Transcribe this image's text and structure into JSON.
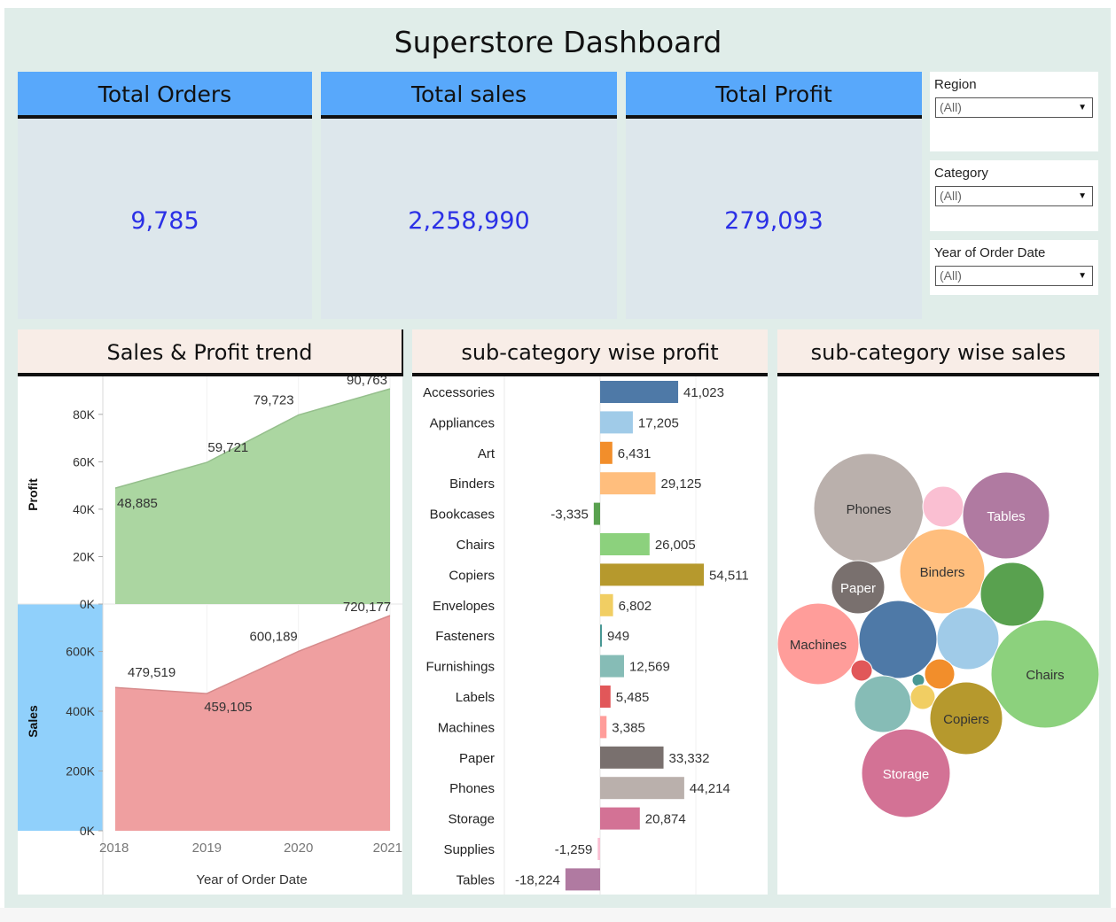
{
  "dashboard": {
    "title": "Superstore Dashboard"
  },
  "kpis": [
    {
      "label": "Total Orders",
      "value": "9,785"
    },
    {
      "label": "Total sales",
      "value": "2,258,990"
    },
    {
      "label": "Total Profit",
      "value": "279,093"
    }
  ],
  "filters": [
    {
      "label": "Region",
      "value": "(All)"
    },
    {
      "label": "Category",
      "value": "(All)"
    },
    {
      "label": "Year of Order Date",
      "value": "(All)"
    }
  ],
  "panels": {
    "trend_title": "Sales & Profit trend",
    "profit_title": "sub-category wise profit",
    "sales_title": "sub-category wise sales"
  },
  "colors": {
    "kpi_header": "#58a8fb",
    "kpi_value": "#2b30e6",
    "profit_area": "#a6d49c",
    "sales_area": "#ee9a9b",
    "sales_band": "#90d0fb"
  },
  "chart_data": [
    {
      "type": "area",
      "xlabel": "Year of Order Date",
      "x": [
        "2018",
        "2019",
        "2020",
        "2021"
      ],
      "series": [
        {
          "name": "Profit",
          "values": [
            48885,
            59721,
            79723,
            90763
          ],
          "labels": [
            "48,885",
            "59,721",
            "79,723",
            "90,763"
          ],
          "ylim": [
            0,
            90763
          ],
          "ticks": [
            0,
            20000,
            40000,
            60000,
            80000
          ],
          "tick_labels": [
            "0K",
            "20K",
            "40K",
            "60K",
            "80K"
          ]
        },
        {
          "name": "Sales",
          "values": [
            479519,
            459105,
            600189,
            720177
          ],
          "labels": [
            "479,519",
            "459,105",
            "600,189",
            "720,177"
          ],
          "ylim": [
            0,
            720177
          ],
          "ticks": [
            0,
            200000,
            400000,
            600000
          ],
          "tick_labels": [
            "0K",
            "200K",
            "400K",
            "600K"
          ]
        }
      ]
    },
    {
      "type": "bar",
      "orientation": "horizontal",
      "categories": [
        "Accessories",
        "Appliances",
        "Art",
        "Binders",
        "Bookcases",
        "Chairs",
        "Copiers",
        "Envelopes",
        "Fasteners",
        "Furnishings",
        "Labels",
        "Machines",
        "Paper",
        "Phones",
        "Storage",
        "Supplies",
        "Tables"
      ],
      "values": [
        41023,
        17205,
        6431,
        29125,
        -3335,
        26005,
        54511,
        6802,
        949,
        12569,
        5485,
        3385,
        33332,
        44214,
        20874,
        -1259,
        -18224
      ],
      "labels": [
        "41,023",
        "17,205",
        "6,431",
        "29,125",
        "-3,335",
        "26,005",
        "54,511",
        "6,802",
        "949",
        "12,569",
        "5,485",
        "3,385",
        "33,332",
        "44,214",
        "20,874",
        "-1,259",
        "-18,224"
      ],
      "colors": [
        "#4e79a7",
        "#a0cbe8",
        "#f28e2b",
        "#ffbe7d",
        "#59a14f",
        "#8cd17d",
        "#b6992d",
        "#f1ce63",
        "#499894",
        "#86bcb6",
        "#e15759",
        "#ff9d9a",
        "#79706e",
        "#bab0ac",
        "#d37295",
        "#fabfd2",
        "#b07aa1"
      ]
    },
    {
      "type": "bubble",
      "bubbles": [
        {
          "name": "Phones",
          "label": "Phones",
          "color": "#bab0ac"
        },
        {
          "name": "Supplies",
          "label": "",
          "color": "#fabfd2"
        },
        {
          "name": "Tables",
          "label": "Tables",
          "color": "#b07aa1"
        },
        {
          "name": "Binders",
          "label": "Binders",
          "color": "#ffbe7d"
        },
        {
          "name": "Paper",
          "label": "Paper",
          "color": "#79706e"
        },
        {
          "name": "Bookcases",
          "label": "",
          "color": "#59a14f"
        },
        {
          "name": "Machines",
          "label": "Machines",
          "color": "#ff9d9a"
        },
        {
          "name": "Accessories",
          "label": "",
          "color": "#4e79a7"
        },
        {
          "name": "Appliances",
          "label": "",
          "color": "#a0cbe8"
        },
        {
          "name": "Chairs",
          "label": "Chairs",
          "color": "#8cd17d"
        },
        {
          "name": "Labels",
          "label": "",
          "color": "#e15759"
        },
        {
          "name": "Furnishings",
          "label": "",
          "color": "#86bcb6"
        },
        {
          "name": "Art",
          "label": "",
          "color": "#f28e2b"
        },
        {
          "name": "Fasteners",
          "label": "",
          "color": "#499894"
        },
        {
          "name": "Envelopes",
          "label": "",
          "color": "#f1ce63"
        },
        {
          "name": "Copiers",
          "label": "Copiers",
          "color": "#b6992d"
        },
        {
          "name": "Storage",
          "label": "Storage",
          "color": "#d37295"
        }
      ]
    }
  ]
}
